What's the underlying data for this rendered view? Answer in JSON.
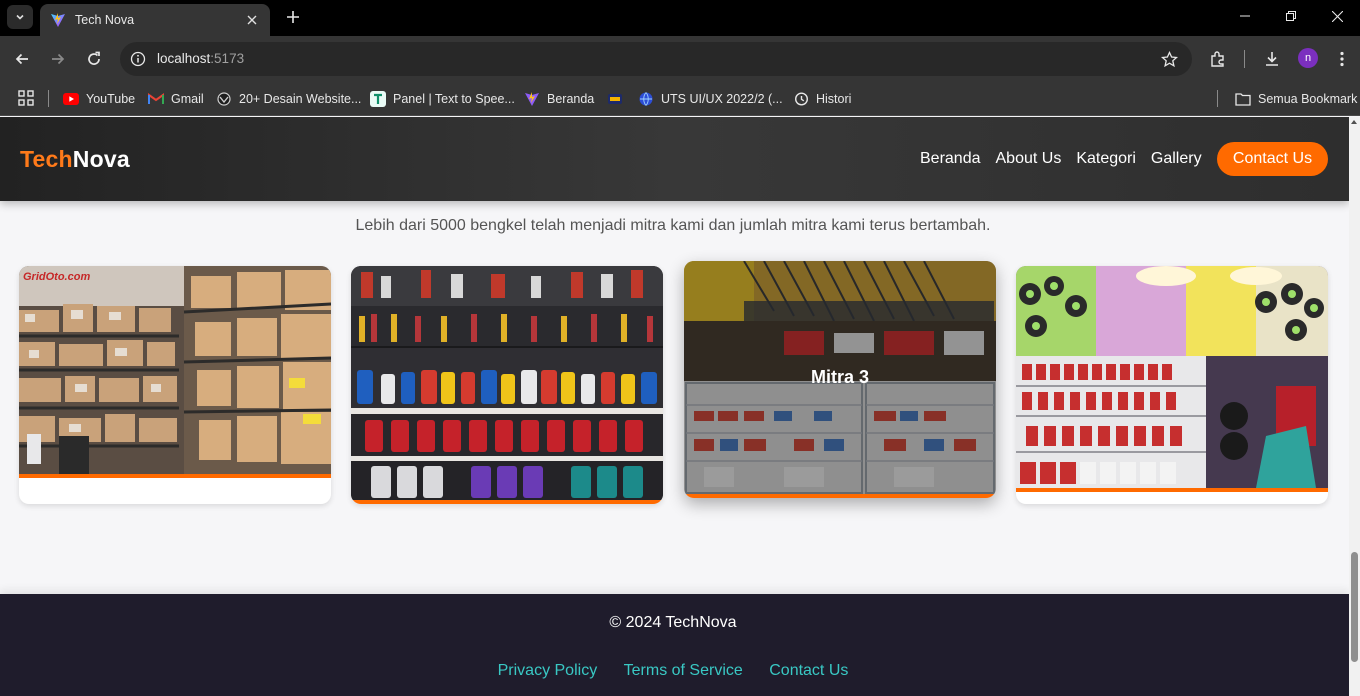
{
  "browser": {
    "tab_title": "Tech Nova",
    "url_host": "localhost",
    "url_port": ":5173",
    "profile_initial": "n",
    "bookmarks": [
      {
        "label": "YouTube",
        "icon": "youtube-icon"
      },
      {
        "label": "Gmail",
        "icon": "gmail-icon"
      },
      {
        "label": "20+ Desain Website...",
        "icon": "site-icon"
      },
      {
        "label": "Panel | Text to Spee...",
        "icon": "t-icon"
      },
      {
        "label": "Beranda",
        "icon": "vite-icon"
      },
      {
        "label": "",
        "icon": "bookmark-app-icon"
      },
      {
        "label": "UTS UI/UX 2022/2 (...",
        "icon": "globe-icon"
      },
      {
        "label": "Histori",
        "icon": "history-icon"
      }
    ],
    "all_bookmarks_label": "Semua Bookmark"
  },
  "site": {
    "logo_part1": "Tech",
    "logo_part2": "Nova",
    "nav": [
      "Beranda",
      "About Us",
      "Kategori",
      "Gallery"
    ],
    "contact_button": "Contact Us",
    "mitra_description": "Lebih dari 5000 bengkel telah menjadi mitra kami dan jumlah mitra kami terus bertambah.",
    "cards": [
      {
        "label": "",
        "watermark": "GridOto.com"
      },
      {
        "label": ""
      },
      {
        "label": "Mitra 3"
      },
      {
        "label": ""
      }
    ],
    "footer": {
      "copyright": "© 2024 TechNova",
      "links": [
        "Privacy Policy",
        "Terms of Service",
        "Contact Us"
      ]
    }
  },
  "colors": {
    "accent": "#ff6a00",
    "logo_accent": "#ff7a1a",
    "footer_bg": "#1f1c2c",
    "footer_link": "#39c8c4"
  }
}
